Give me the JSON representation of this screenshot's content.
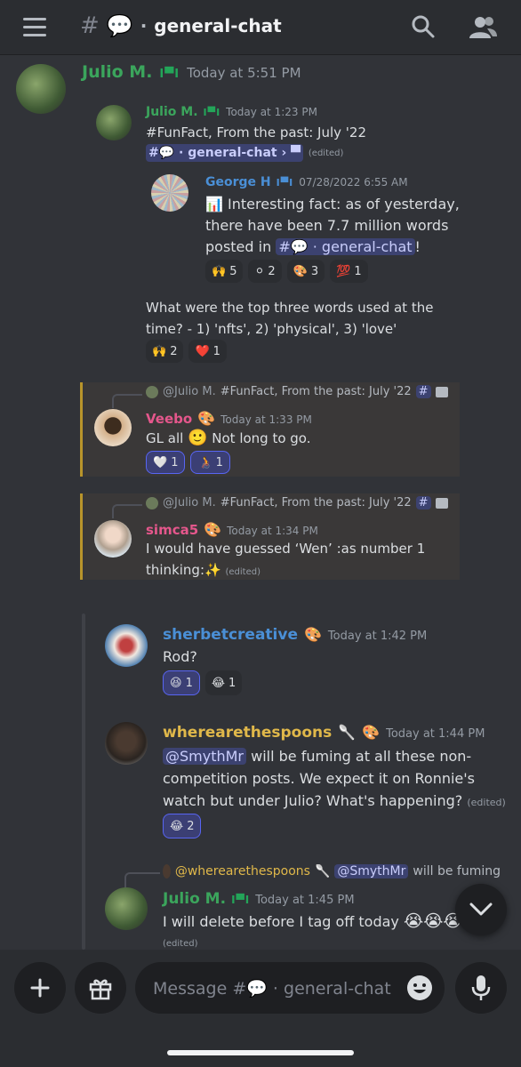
{
  "channel": {
    "emoji": "💬",
    "dot": "·",
    "name": "general-chat"
  },
  "messages": {
    "main": {
      "author": "Julio M.",
      "time": "Today at 5:51 PM"
    },
    "fwd1": {
      "author": "Julio M.",
      "time": "Today at 1:23 PM",
      "text": "#FunFact, From the past: July '22",
      "channel_link": "general-chat",
      "edited": "(edited)"
    },
    "fwd2": {
      "author": "George H",
      "time": "07/28/2022 6:55 AM",
      "line1": "Interesting fact: as of yesterday,",
      "line2": "there have been 7.7 million words",
      "line3_pre": "posted in",
      "line3_link": "general-chat",
      "line3_post": "!",
      "reactions": [
        {
          "emoji": "🙌",
          "count": "5"
        },
        {
          "emoji": "⚪",
          "count": "2"
        },
        {
          "emoji": "🎨",
          "count": "3"
        },
        {
          "emoji": "💯",
          "count": "1"
        }
      ]
    },
    "fwd1_body": {
      "line1": "What were the top three words used at the",
      "line2": "time? - 1) 'nfts', 2) 'physical', 3) 'love'",
      "reactions": [
        {
          "emoji": "🙌",
          "count": "2"
        },
        {
          "emoji": "❤️",
          "count": "1"
        }
      ]
    },
    "veebo": {
      "reply_to": "@Julio M.",
      "reply_text": "#FunFact, From the past: July '22",
      "author": "Veebo",
      "time": "Today at 1:33 PM",
      "text_pre": "GL all",
      "text_emoji": "🙂",
      "text_post": "Not long to go.",
      "reactions": [
        {
          "emoji": "🤍",
          "count": "1"
        },
        {
          "emoji": "🧑‍🦽",
          "count": "1"
        }
      ]
    },
    "simca": {
      "reply_to": "@Julio M.",
      "reply_text": "#FunFact, From the past: July '22",
      "author": "simca5",
      "time": "Today at 1:34 PM",
      "line1": "I would have guessed ‘Wen’ :as number 1",
      "line2": "thinking:",
      "sparkle": "✨",
      "edited": "(edited)"
    },
    "sherbet": {
      "author": "sherbetcreative",
      "time": "Today at 1:42 PM",
      "text": "Rod?",
      "reactions": [
        {
          "emoji": "😆",
          "count": "1"
        },
        {
          "emoji": "😂",
          "count": "1"
        }
      ]
    },
    "spoons": {
      "author": "wherearethespoons",
      "time": "Today at 1:44 PM",
      "mention": "@SmythMr",
      "line1": "will be fuming at all these non-",
      "line2": "competition posts. We expect it on Ronnie's",
      "line3": "watch but under Julio? What's happening?",
      "edited": "(edited)",
      "reactions": [
        {
          "emoji": "😂",
          "count": "2"
        }
      ]
    },
    "julio_last": {
      "reply_to": "@wherearethespoons",
      "reply_mention": "@SmythMr",
      "reply_text": "will be fuming",
      "author": "Julio M.",
      "time": "Today at 1:45 PM",
      "text": "I will delete before I tag off today",
      "emojis": "😭😭😭",
      "edited": "(edited)"
    }
  },
  "composer": {
    "placeholder": "Message #💬 · general-chat"
  },
  "badge": "I▀I"
}
